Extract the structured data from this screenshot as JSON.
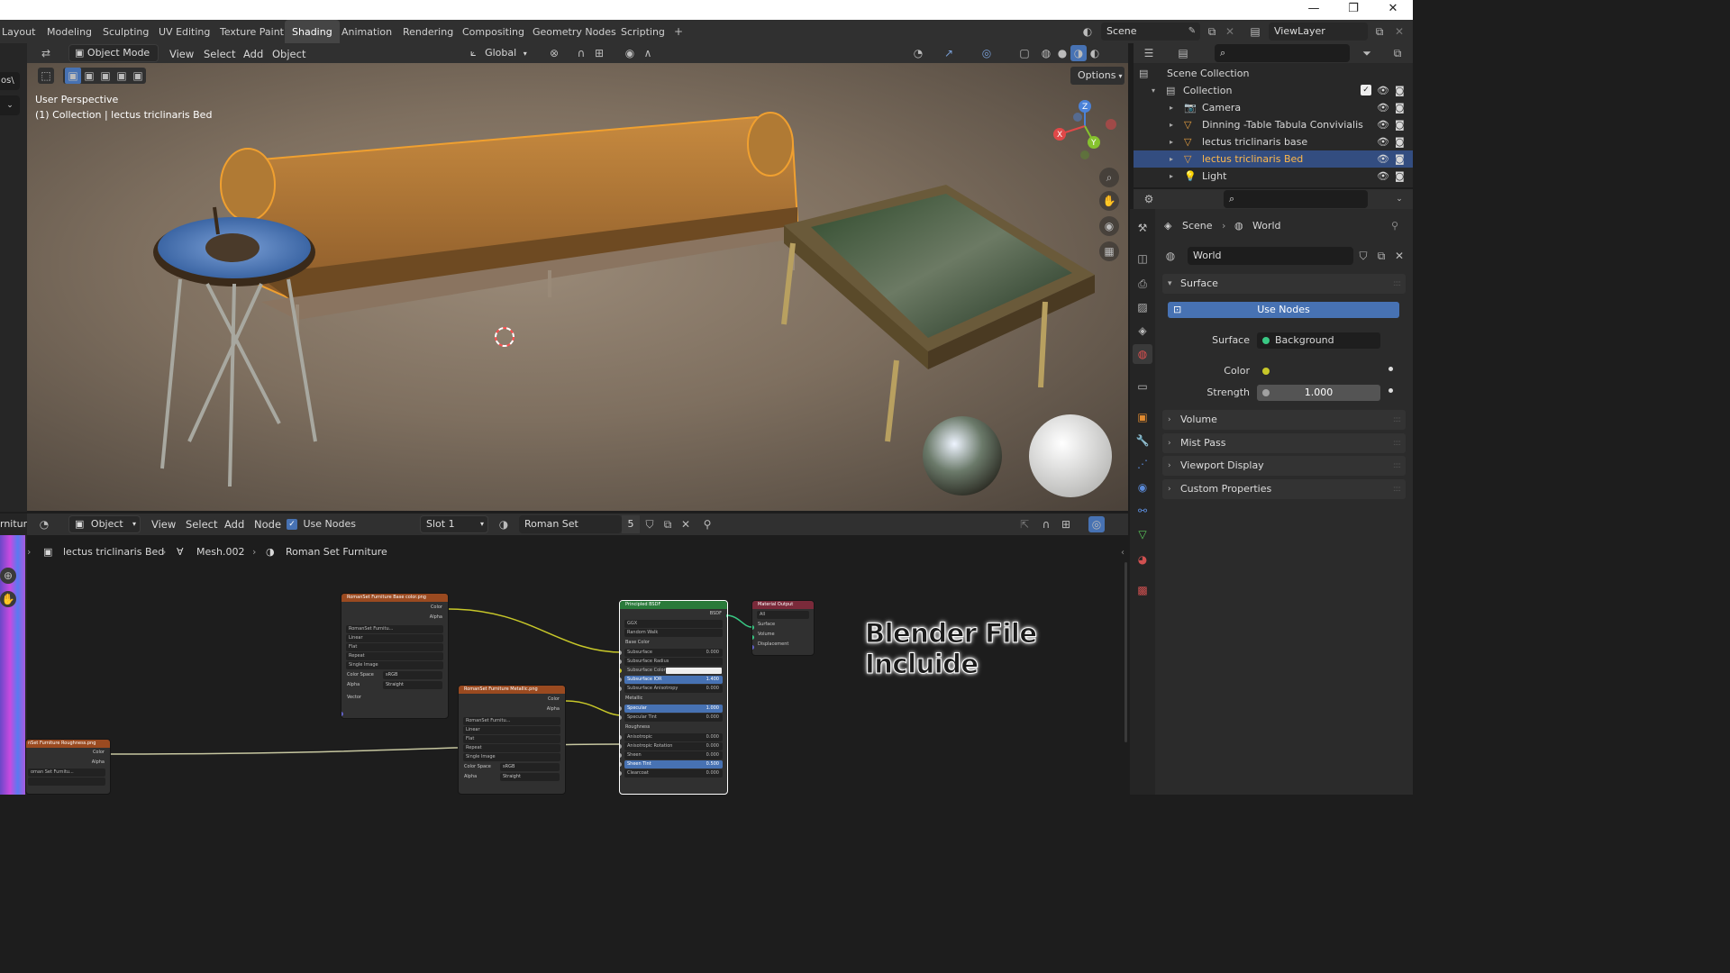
{
  "window": {
    "minimize": "—",
    "maximize": "❐",
    "close": "✕"
  },
  "workspaces": [
    {
      "label": "Layout"
    },
    {
      "label": "Modeling"
    },
    {
      "label": "Sculpting"
    },
    {
      "label": "UV Editing"
    },
    {
      "label": "Texture Paint"
    },
    {
      "label": "Shading"
    },
    {
      "label": "Animation"
    },
    {
      "label": "Rendering"
    },
    {
      "label": "Compositing"
    },
    {
      "label": "Geometry Nodes"
    },
    {
      "label": "Scripting"
    }
  ],
  "active_workspace": "Shading",
  "add_workspace": "+",
  "scene_name": "Scene",
  "view_layer": "ViewLayer",
  "left_strip_text": "os\\",
  "viewport_header": {
    "mode": "Object Mode",
    "menus": [
      "View",
      "Select",
      "Add",
      "Object"
    ],
    "transform_orientation": "Global",
    "options": "Options"
  },
  "viewport": {
    "perspective": "User Perspective",
    "collection_info": "(1) Collection | lectus triclinaris Bed",
    "gizmo": {
      "x": "X",
      "y": "Y",
      "z": "Z"
    }
  },
  "node_header": {
    "left_text": "rniture",
    "object_type": "Object",
    "menus": [
      "View",
      "Select",
      "Add",
      "Node"
    ],
    "use_nodes": "Use Nodes",
    "slot": "Slot 1",
    "material": "Roman Set Furniture",
    "users": "5"
  },
  "node_breadcrumb": {
    "object": "lectus triclinaris Bed",
    "mesh": "Mesh.002",
    "material": "Roman Set Furniture"
  },
  "watermark": "Blender File Incluide",
  "nodes": {
    "base_color": {
      "title": "RomanSet Furniture Base color.png",
      "out_color": "Color",
      "out_alpha": "Alpha",
      "image": "RomanSet Furnitu...",
      "interp": "Linear",
      "proj": "Flat",
      "ext": "Repeat",
      "src": "Single Image",
      "cs_label": "Color Space",
      "cs_value": "sRGB",
      "alpha_label": "Alpha",
      "alpha_value": "Straight",
      "vector": "Vector"
    },
    "metallic": {
      "title": "RomanSet Furniture Metallic.png",
      "out_color": "Color",
      "out_alpha": "Alpha",
      "image": "RomanSet Furnitu...",
      "interp": "Linear",
      "proj": "Flat",
      "ext": "Repeat",
      "src": "Single Image",
      "cs_label": "Color Space",
      "cs_value": "sRGB",
      "alpha_label": "Alpha",
      "alpha_value": "Straight"
    },
    "roughness": {
      "title": "nSet Furniture Roughness.png",
      "out_color": "Color",
      "out_alpha": "Alpha",
      "image": "oman Set Furnitu..."
    },
    "bsdf": {
      "title": "Principled BSDF",
      "out": "BSDF",
      "dist": "GGX",
      "sss_method": "Random Walk",
      "rows": [
        {
          "label": "Base Color",
          "value": "",
          "kind": "label"
        },
        {
          "label": "Subsurface",
          "value": "0.000",
          "kind": "field"
        },
        {
          "label": "Subsurface Radius",
          "value": "",
          "kind": "field"
        },
        {
          "label": "Subsurface Color",
          "value": "",
          "kind": "color"
        },
        {
          "label": "Subsurface IOR",
          "value": "1.400",
          "kind": "blue"
        },
        {
          "label": "Subsurface Anisotropy",
          "value": "0.000",
          "kind": "field"
        },
        {
          "label": "Metallic",
          "value": "",
          "kind": "label"
        },
        {
          "label": "Specular",
          "value": "1.000",
          "kind": "blue"
        },
        {
          "label": "Specular Tint",
          "value": "0.000",
          "kind": "field"
        },
        {
          "label": "Roughness",
          "value": "",
          "kind": "label"
        },
        {
          "label": "Anisotropic",
          "value": "0.000",
          "kind": "field"
        },
        {
          "label": "Anisotropic Rotation",
          "value": "0.000",
          "kind": "field"
        },
        {
          "label": "Sheen",
          "value": "0.000",
          "kind": "field"
        },
        {
          "label": "Sheen Tint",
          "value": "0.500",
          "kind": "blue"
        },
        {
          "label": "Clearcoat",
          "value": "0.000",
          "kind": "field"
        }
      ]
    },
    "output": {
      "title": "Material Output",
      "target": "All",
      "surface": "Surface",
      "volume": "Volume",
      "displacement": "Displacement"
    }
  },
  "outliner": {
    "root": "Scene Collection",
    "collection": "Collection",
    "items": [
      {
        "label": "Camera",
        "color": "#e07a3c"
      },
      {
        "label": "Dinning -Table Tabula Convivialis",
        "color": "#e8a040"
      },
      {
        "label": "lectus triclinaris base",
        "color": "#e8a040"
      },
      {
        "label": "lectus triclinaris Bed",
        "color": "#e8a040",
        "selected": true
      },
      {
        "label": "Light",
        "color": "#e0b050"
      }
    ]
  },
  "properties": {
    "breadcrumb_scene": "Scene",
    "breadcrumb_world": "World",
    "world_name": "World",
    "surface_panel": "Surface",
    "use_nodes": "Use Nodes",
    "surface_label": "Surface",
    "surface_value": "Background",
    "color_label": "Color",
    "strength_label": "Strength",
    "strength_value": "1.000",
    "panels": [
      "Volume",
      "Mist Pass",
      "Viewport Display",
      "Custom Properties"
    ]
  },
  "colors": {
    "accent": "#4772b3",
    "selection": "#334d80",
    "object_outline": "#f0a030"
  }
}
